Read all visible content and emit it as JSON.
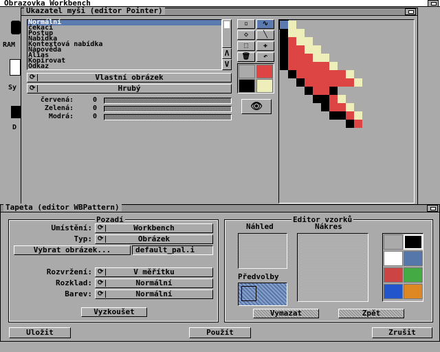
{
  "screen": {
    "title": "Obrazovka Workbench"
  },
  "desktop_icons": [
    {
      "label": "RAM"
    },
    {
      "label": "Sy"
    },
    {
      "label": "D"
    }
  ],
  "pointer_editor": {
    "title": "Ukazatel myši (editor Pointer)",
    "list_items": [
      "Normální",
      "čekací",
      "Postup",
      "Nabídka",
      "Kontextová nabídka",
      "Nápověda",
      "Alias",
      "Kopírovat",
      "Odkaz"
    ],
    "selected_index": 0,
    "custom_image_cycle": "Vlastní obrázek",
    "resolution_cycle": "Hrubý",
    "sliders": [
      {
        "label": "červená:",
        "value": "0"
      },
      {
        "label": "Zelená:",
        "value": "0"
      },
      {
        "label": "Modrá:",
        "value": "0"
      }
    ],
    "tools": [
      "point-icon",
      "line-icon",
      "fill-icon",
      "line2-icon",
      "select-icon",
      "move-icon",
      "clear-icon",
      "undo-icon"
    ],
    "palette": [
      "#aaaaaa",
      "#dd4444",
      "#000000",
      "#eeeebb"
    ],
    "eye_icon": "eye-icon",
    "colors": {
      "black": "#000000",
      "red": "#dd4444",
      "cream": "#eeeebb",
      "hotspot": "#5a7ab0"
    },
    "bitmap": [
      "HC..............",
      "BCC.............",
      "BRCC............",
      "BRRCC...........",
      "BRRRCC..........",
      "BRRRRRC.........",
      ".BRRRRRRC.......",
      "..BRRRRRRC......",
      "...BRRB.........",
      "....BBRC........",
      ".....BRRC.......",
      "......BBRC......",
      "........BR......",
      "................"
    ]
  },
  "pattern_editor": {
    "title": "Tapeta (editor WBPattern)",
    "background_group": "Pozadí",
    "placement_label": "Umístění:",
    "placement_value": "Workbench",
    "type_label": "Typ:",
    "type_value": "Obrázek",
    "pick_image_label": "Vybrat obrázek...",
    "image_file": "default_pal.i",
    "layout_label": "Rozvržení:",
    "layout_value": "V měřítku",
    "dither_label": "Rozklad:",
    "dither_value": "Normální",
    "colors_label": "Barev:",
    "colors_value": "Normální",
    "try_label": "Vyzkoušet",
    "pattern_group": "Editor vzorků",
    "preview_label": "Náhled",
    "drawing_label": "Nákres",
    "presets_label": "Předvolby",
    "clear_label": "Vymazat",
    "undo_label": "Zpět",
    "pattern_palette": [
      "#aaaaaa",
      "#000000",
      "#ffffff",
      "#5577aa",
      "#cc4444",
      "#44aa44",
      "#2255cc",
      "#dd8822"
    ],
    "save_label": "Uložit",
    "use_label": "Použít",
    "cancel_label": "Zrušit"
  }
}
